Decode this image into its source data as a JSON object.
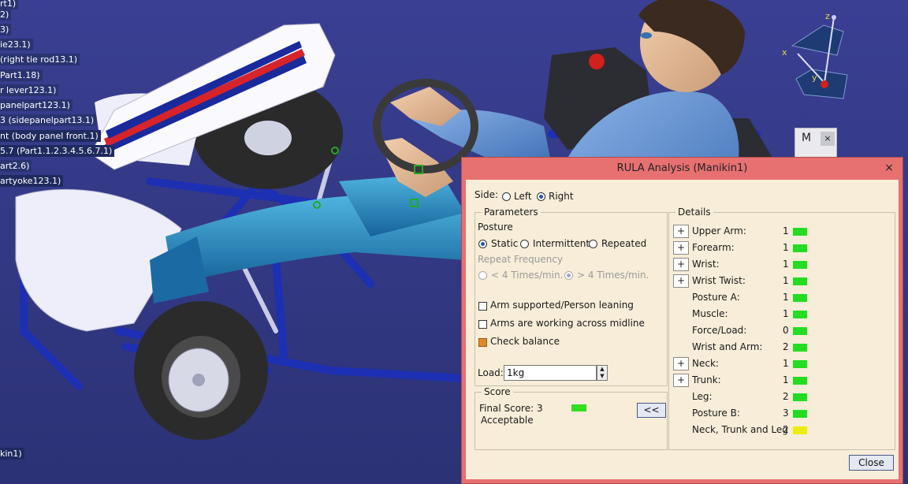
{
  "tree": {
    "items": [
      "rt1)",
      "2)",
      "3)",
      "ie23.1)",
      "(right tie rod13.1)",
      "Part1.18)",
      "r lever123.1)",
      "panelpart123.1)",
      "3 (sidepanelpart13.1)",
      "nt (body panel front.1)",
      "5.7 (Part1.1.2.3.4.5.6.7.1)",
      "art2.6)",
      "artyoke123.1)",
      "kin1)"
    ]
  },
  "compass": {
    "x_label": "x",
    "y_label": "y",
    "z_label": "z"
  },
  "mini_widget": {
    "label": "M",
    "close": "×"
  },
  "dialog": {
    "title": "RULA Analysis (Manikin1)",
    "close": "×",
    "side": {
      "label": "Side:",
      "left": "Left",
      "right": "Right",
      "selected": "Right"
    },
    "parameters": {
      "group_label": "Parameters",
      "posture_label": "Posture",
      "posture_options": [
        "Static",
        "Intermittent",
        "Repeated"
      ],
      "posture_selected": "Static",
      "repeat_label": "Repeat Frequency",
      "repeat_options": [
        "< 4 Times/min.",
        "> 4 Times/min."
      ],
      "repeat_selected": "> 4 Times/min.",
      "checks": [
        {
          "label": "Arm supported/Person leaning",
          "checked": false
        },
        {
          "label": "Arms are working across midline",
          "checked": false
        },
        {
          "label": "Check balance",
          "checked": true
        }
      ],
      "load_label": "Load:",
      "load_value": "1kg"
    },
    "score": {
      "group_label": "Score",
      "final_label": "Final Score: 3",
      "status": "Acceptable",
      "color": "#33dd22",
      "toggle_label": "<<"
    },
    "details": {
      "group_label": "Details",
      "rows": [
        {
          "label": "Upper Arm:",
          "value": "1",
          "color": "#22dd22",
          "expandable": true
        },
        {
          "label": "Forearm:",
          "value": "1",
          "color": "#22dd22",
          "expandable": true
        },
        {
          "label": "Wrist:",
          "value": "1",
          "color": "#22dd22",
          "expandable": true
        },
        {
          "label": "Wrist Twist:",
          "value": "1",
          "color": "#22dd22",
          "expandable": true
        },
        {
          "label": "Posture A:",
          "value": "1",
          "color": "#22dd22",
          "expandable": false
        },
        {
          "label": "Muscle:",
          "value": "1",
          "color": "#22dd22",
          "expandable": false
        },
        {
          "label": "Force/Load:",
          "value": "0",
          "color": "#22dd22",
          "expandable": false
        },
        {
          "label": "Wrist and Arm:",
          "value": "2",
          "color": "#22dd22",
          "expandable": false
        },
        {
          "label": "Neck:",
          "value": "1",
          "color": "#22dd22",
          "expandable": true
        },
        {
          "label": "Trunk:",
          "value": "1",
          "color": "#22dd22",
          "expandable": true
        },
        {
          "label": "Leg:",
          "value": "2",
          "color": "#22dd22",
          "expandable": false
        },
        {
          "label": "Posture B:",
          "value": "3",
          "color": "#22dd22",
          "expandable": false
        },
        {
          "label": "Neck, Trunk and Leg",
          "value": "2",
          "color": "#eeee00",
          "expandable": false
        }
      ]
    },
    "close_button": "Close"
  }
}
